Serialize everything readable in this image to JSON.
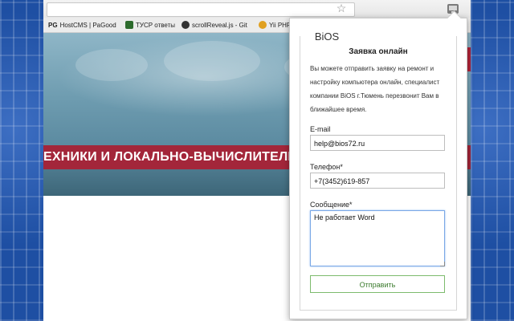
{
  "bookmarks": [
    {
      "label": "HostCMS | PaGood",
      "prefix": "PG",
      "color": "#222222"
    },
    {
      "label": "ТУСР ответы",
      "prefix": "",
      "color": "#2d6b2d"
    },
    {
      "label": "scrollReveal.js - Git",
      "prefix": "",
      "color": "#333333"
    },
    {
      "label": "Yii PHP",
      "prefix": "",
      "color": "#e0a020"
    }
  ],
  "hero": {
    "banner_text": "ЕХНИКИ И ЛОКАЛЬНО-ВЫЧИСЛИТЕЛЬН"
  },
  "popup": {
    "logo_text": "BiOS",
    "title": "Заявка онлайн",
    "description": "Вы можете отправить заявку на ремонт и настройку компьютера онлайн, специалист компании BiOS г.Тюмень перезвонит Вам в ближайшее время.",
    "email_label": "E-mail",
    "email_value": "help@bios72.ru",
    "phone_label": "Телефон*",
    "phone_value": "+7(3452)619-857",
    "message_label": "Сообщение*",
    "message_value": "Не работает Word",
    "submit_label": "Отправить"
  },
  "icons": {
    "star": "star-icon",
    "extension": "bios-extension-icon"
  },
  "colors": {
    "accent_green": "#3a7a2c",
    "banner_red": "#a3263a",
    "background_blue": "#1e4fa3"
  }
}
